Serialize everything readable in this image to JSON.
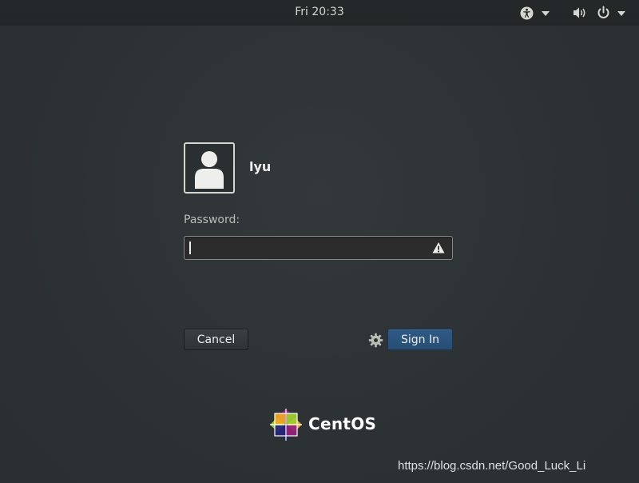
{
  "topbar": {
    "clock": "Fri 20:33",
    "icons": [
      "accessibility-icon",
      "volume-icon",
      "power-icon"
    ]
  },
  "login": {
    "username": "lyu",
    "password_label": "Password:",
    "password_value": "",
    "warning_icon": "warning-icon",
    "cancel_label": "Cancel",
    "signin_label": "Sign In",
    "settings_icon": "gear-icon"
  },
  "branding": {
    "logo_text": "CentOS"
  },
  "watermark": {
    "text": "https://blog.csdn.net/Good_Luck_Li"
  },
  "colors": {
    "background": "#2e3436",
    "topbar": "#232627",
    "signin_button": "#2a5179",
    "text": "#eeeeec"
  }
}
